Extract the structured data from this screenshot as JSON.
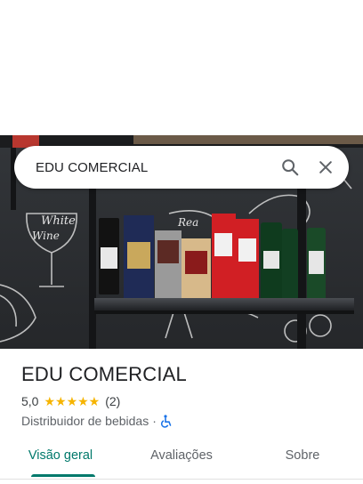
{
  "search": {
    "query": "EDU COMERCIAL"
  },
  "place": {
    "name": "EDU COMERCIAL",
    "rating": "5,0",
    "stars": "★★★★★",
    "review_count": "(2)",
    "category": "Distribuidor de bebidas",
    "separator": "·"
  },
  "tabs": [
    {
      "label": "Visão geral",
      "active": true
    },
    {
      "label": "Avaliações",
      "active": false
    },
    {
      "label": "Sobre",
      "active": false
    }
  ],
  "photo": {
    "wall_text_1": "White",
    "wall_text_2": "Wine",
    "wall_text_3": "Rea"
  },
  "colors": {
    "accent": "#00796b",
    "stars": "#f6b400",
    "accessibility": "#1a73e8"
  },
  "icons": {
    "search": "search-icon",
    "close": "close-icon",
    "accessibility": "wheelchair-icon"
  }
}
